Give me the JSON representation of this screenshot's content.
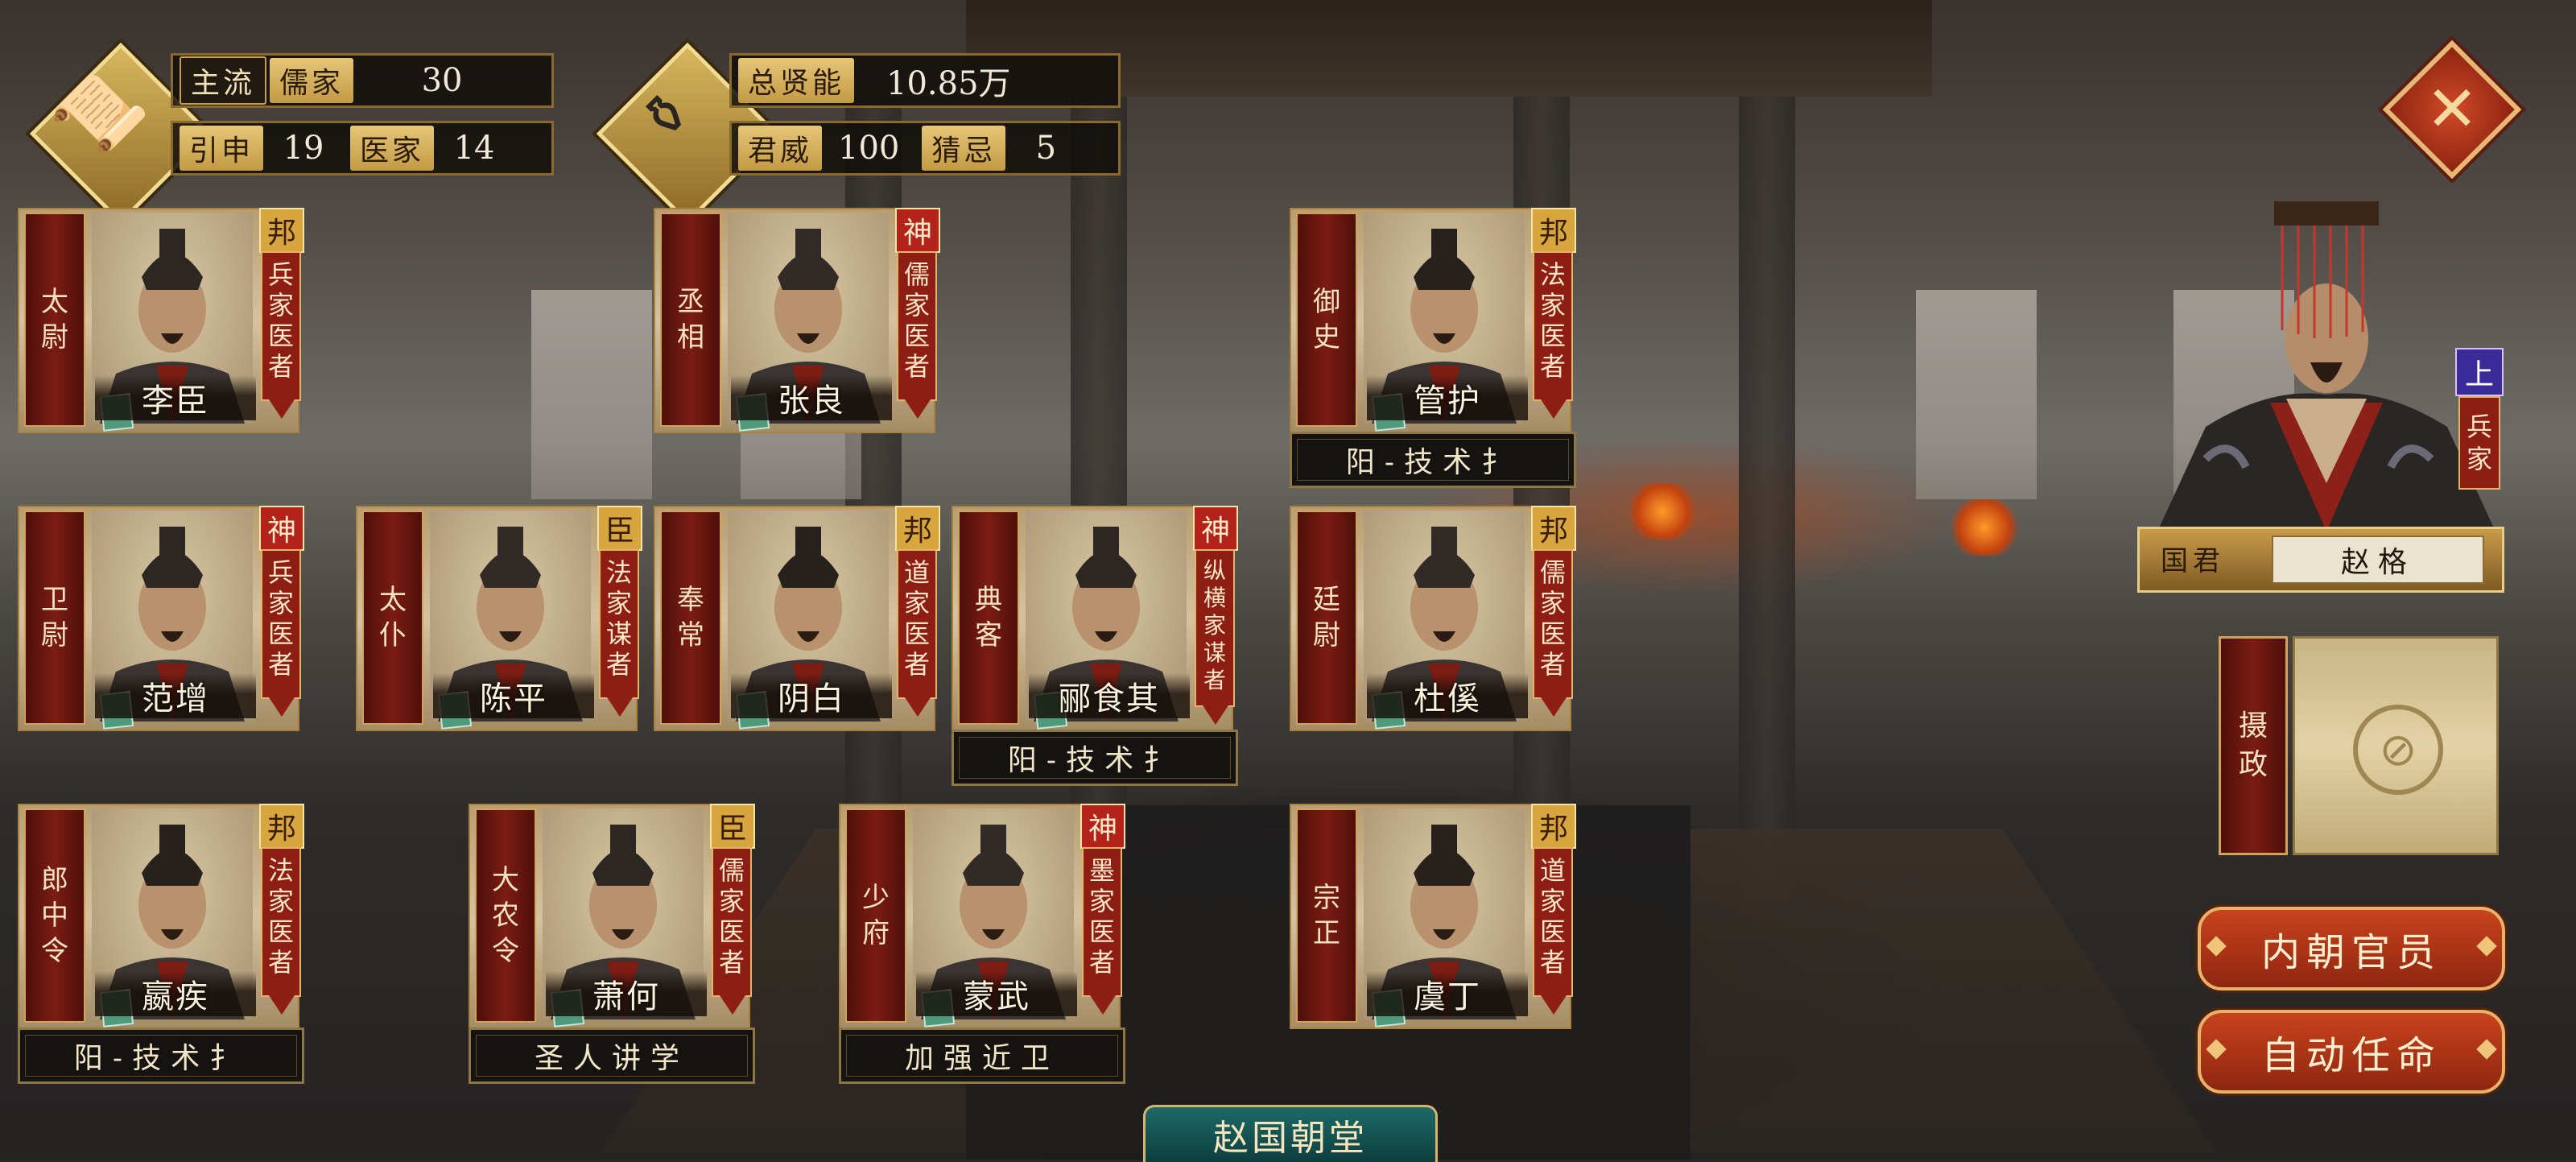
{
  "stats_left": {
    "mainstream_label": "主流",
    "mainstream_school": "儒家",
    "mainstream_value": "30",
    "item2_label": "引申",
    "item2_value": "19",
    "item3_label": "医家",
    "item3_value": "14"
  },
  "stats_right": {
    "talent_label": "总贤能",
    "talent_value": "10.85万",
    "prestige_label": "君威",
    "prestige_value": "100",
    "suspicion_label": "猜忌",
    "suspicion_value": "5"
  },
  "officials": [
    {
      "title": "太尉",
      "name": "李臣",
      "rank": "邦",
      "rank_type": "bang",
      "school": [
        "兵",
        "家",
        "医",
        "者"
      ]
    },
    {
      "title": "丞相",
      "name": "张良",
      "rank": "神",
      "rank_type": "shen",
      "school": [
        "儒",
        "家",
        "医",
        "者"
      ]
    },
    {
      "title": "御史",
      "name": "管护",
      "rank": "邦",
      "rank_type": "bang",
      "school": [
        "法",
        "家",
        "医",
        "者"
      ],
      "policy": "阳-技术扌"
    },
    {
      "title": "卫尉",
      "name": "范增",
      "rank": "神",
      "rank_type": "shen",
      "school": [
        "兵",
        "家",
        "医",
        "者"
      ]
    },
    {
      "title": "太仆",
      "name": "陈平",
      "rank": "臣",
      "rank_type": "chen",
      "school": [
        "法",
        "家",
        "谋",
        "者"
      ]
    },
    {
      "title": "奉常",
      "name": "阴白",
      "rank": "邦",
      "rank_type": "bang",
      "school": [
        "道",
        "家",
        "医",
        "者"
      ]
    },
    {
      "title": "典客",
      "name": "郦食其",
      "rank": "神",
      "rank_type": "shen",
      "school": [
        "纵",
        "横",
        "家",
        "谋",
        "者"
      ],
      "policy": "阳-技术扌"
    },
    {
      "title": "廷尉",
      "name": "杜傒",
      "rank": "邦",
      "rank_type": "bang",
      "school": [
        "儒",
        "家",
        "医",
        "者"
      ]
    },
    {
      "title": "郎中令",
      "name": "嬴疾",
      "rank": "邦",
      "rank_type": "bang",
      "school": [
        "法",
        "家",
        "医",
        "者"
      ],
      "policy": "阳-技术扌"
    },
    {
      "title": "大农令",
      "name": "萧何",
      "rank": "臣",
      "rank_type": "chen",
      "school": [
        "儒",
        "家",
        "医",
        "者"
      ],
      "policy": "圣人讲学"
    },
    {
      "title": "少府",
      "name": "蒙武",
      "rank": "神",
      "rank_type": "shen",
      "school": [
        "墨",
        "家",
        "医",
        "者"
      ],
      "policy": "加强近卫"
    },
    {
      "title": "宗正",
      "name": "虞丁",
      "rank": "邦",
      "rank_type": "bang",
      "school": [
        "道",
        "家",
        "医",
        "者"
      ]
    }
  ],
  "ruler": {
    "title": "国君",
    "name": "赵格",
    "badge": "上",
    "school": [
      "兵",
      "家"
    ]
  },
  "regent": {
    "label_chars": [
      "摄",
      "政"
    ]
  },
  "buttons": {
    "inner_court": "内朝官员",
    "auto_appoint": "自动任命",
    "close": "✕"
  },
  "bottom_tab": "赵国朝堂",
  "colors": {
    "accent_red": "#8e1d14",
    "gold": "#d7a63f",
    "teal": "#1c6a69"
  }
}
